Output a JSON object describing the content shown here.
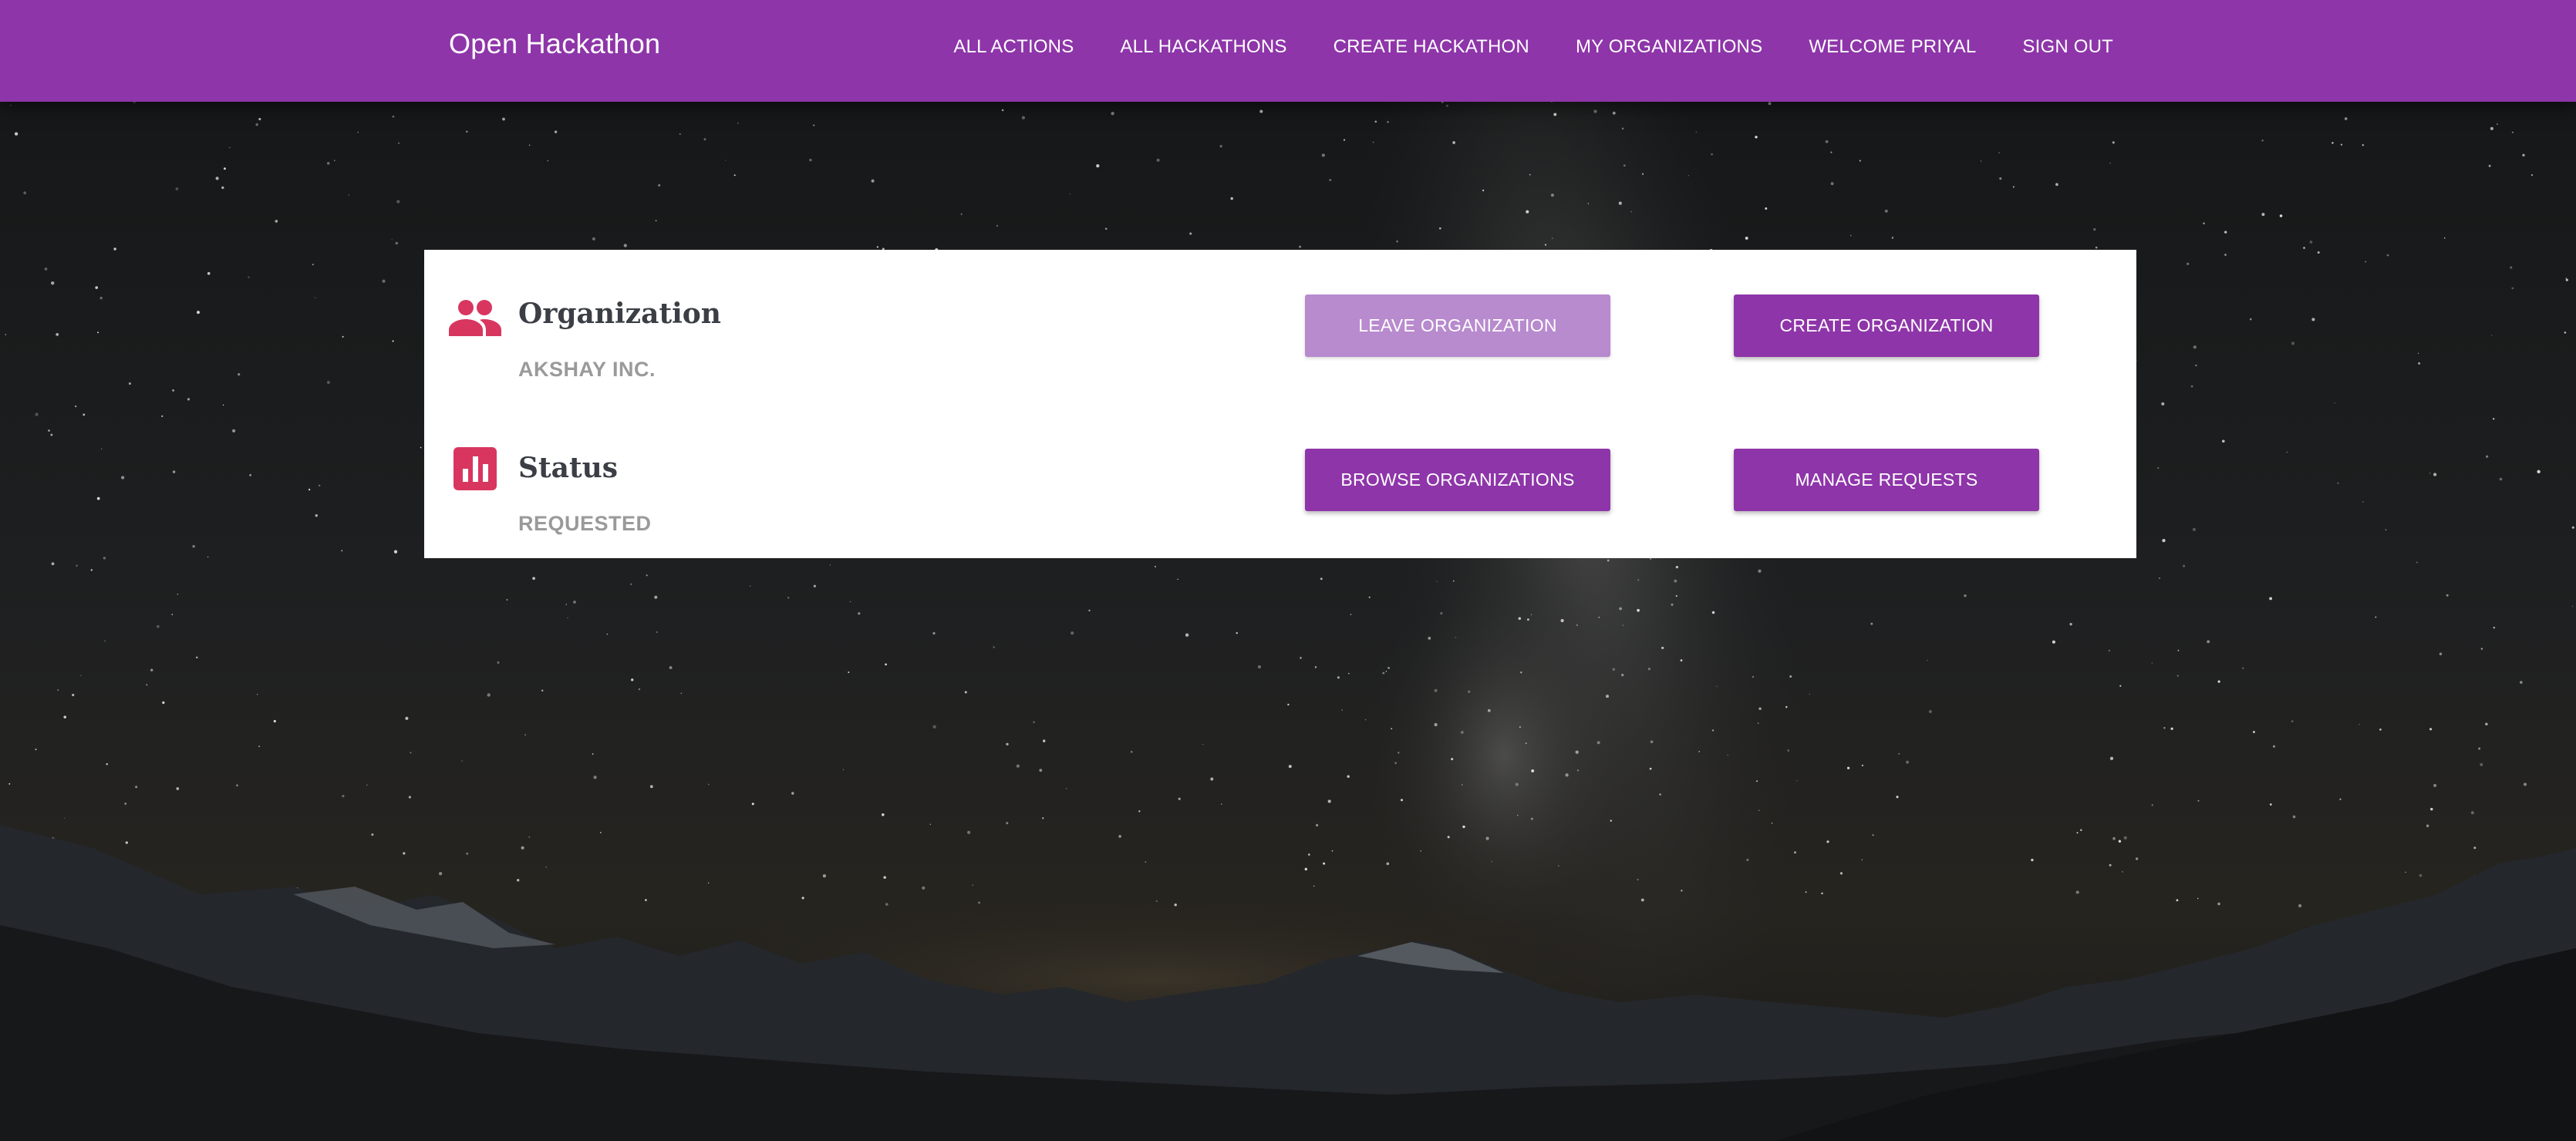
{
  "navbar": {
    "brand": "Open Hackathon",
    "links": [
      "ALL ACTIONS",
      "ALL HACKATHONS",
      "CREATE HACKATHON",
      "MY ORGANIZATIONS",
      "WELCOME PRIYAL",
      "SIGN OUT"
    ],
    "color": "#8e35a9"
  },
  "card": {
    "organization": {
      "icon": "people-icon",
      "title": "Organization",
      "value": "AKSHAY INC."
    },
    "status": {
      "icon": "bar-chart-icon",
      "title": "Status",
      "value": "REQUESTED"
    },
    "buttons": {
      "leave": "LEAVE ORGANIZATION",
      "create": "CREATE ORGANIZATION",
      "browse": "BROWSE ORGANIZATIONS",
      "manage": "MANAGE REQUESTS"
    },
    "icon_color": "#d8365f"
  }
}
